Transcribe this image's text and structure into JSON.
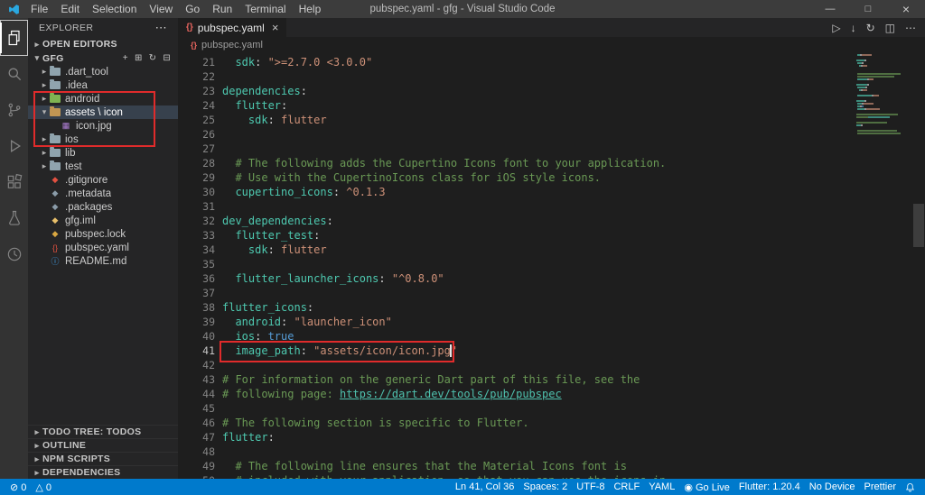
{
  "titlebar": {
    "title": "pubspec.yaml - gfg - Visual Studio Code",
    "menus": [
      "File",
      "Edit",
      "Selection",
      "View",
      "Go",
      "Run",
      "Terminal",
      "Help"
    ],
    "window_controls": {
      "minimize": "—",
      "maximize": "□",
      "close": "×"
    }
  },
  "icons": {
    "chevron_right": "▸",
    "chevron_down": "▾"
  },
  "activity_bar": {
    "items": [
      "explorer",
      "search",
      "source-control",
      "run-debug",
      "extensions",
      "test",
      "flutter-devtools"
    ]
  },
  "sidebar": {
    "header": "EXPLORER",
    "header_more": "⋯",
    "open_editors_label": "OPEN EDITORS",
    "project": "GFG",
    "project_actions": [
      {
        "name": "new-file",
        "glyph": "+"
      },
      {
        "name": "new-folder",
        "glyph": "⊞"
      },
      {
        "name": "refresh-explorer",
        "glyph": "↻"
      },
      {
        "name": "collapse-folders",
        "glyph": "⊟"
      }
    ],
    "tree": [
      {
        "label": ".dart_tool",
        "depth": 0,
        "kind": "folder",
        "expanded": false,
        "color": "#90a4ae"
      },
      {
        "label": ".idea",
        "depth": 0,
        "kind": "folder",
        "expanded": false,
        "color": "#90a4ae"
      },
      {
        "label": "android",
        "depth": 0,
        "kind": "folder",
        "expanded": false,
        "color": "#7fb352"
      },
      {
        "label": "assets \\ icon",
        "depth": 0,
        "kind": "folder",
        "expanded": true,
        "selected": true,
        "color": "#c09553"
      },
      {
        "label": "icon.jpg",
        "depth": 1,
        "kind": "file",
        "glyph": "▦",
        "color": "#b180d7"
      },
      {
        "label": "ios",
        "depth": 0,
        "kind": "folder",
        "expanded": false,
        "color": "#90a4ae"
      },
      {
        "label": "lib",
        "depth": 0,
        "kind": "folder",
        "expanded": false,
        "color": "#90a4ae"
      },
      {
        "label": "test",
        "depth": 0,
        "kind": "folder",
        "expanded": false,
        "color": "#90a4ae"
      },
      {
        "label": ".gitignore",
        "depth": 0,
        "kind": "file",
        "glyph": "◆",
        "color": "#e25141"
      },
      {
        "label": ".metadata",
        "depth": 0,
        "kind": "file",
        "glyph": "◆",
        "color": "#8a9ba8"
      },
      {
        "label": ".packages",
        "depth": 0,
        "kind": "file",
        "glyph": "◆",
        "color": "#8a9ba8"
      },
      {
        "label": "gfg.iml",
        "depth": 0,
        "kind": "file",
        "glyph": "◆",
        "color": "#e8bf6a"
      },
      {
        "label": "pubspec.lock",
        "depth": 0,
        "kind": "file",
        "glyph": "◆",
        "color": "#d9a741"
      },
      {
        "label": "pubspec.yaml",
        "depth": 0,
        "kind": "file",
        "glyph": "{}",
        "color": "#e25141"
      },
      {
        "label": "README.md",
        "depth": 0,
        "kind": "file",
        "glyph": "ⓘ",
        "color": "#42a5f5"
      }
    ],
    "bottom_sections": [
      "TODO TREE: TODOS",
      "OUTLINE",
      "NPM SCRIPTS",
      "DEPENDENCIES"
    ]
  },
  "editor": {
    "tab": {
      "label": "pubspec.yaml",
      "icon_glyph": "{}",
      "close": "×"
    },
    "breadcrumb": "pubspec.yaml",
    "actions": [
      {
        "name": "run",
        "glyph": "▷"
      },
      {
        "name": "download",
        "glyph": "↓"
      },
      {
        "name": "sync",
        "glyph": "↻"
      },
      {
        "name": "split-editor",
        "glyph": "◫"
      },
      {
        "name": "more-actions",
        "glyph": "⋯"
      }
    ],
    "cursor": {
      "line": 41,
      "col": 36
    },
    "lines": [
      {
        "n": 21,
        "t": [
          [
            "  sdk",
            "k"
          ],
          [
            ": ",
            "p"
          ],
          [
            "\">=2.7.0 <3.0.0\"",
            "s"
          ]
        ]
      },
      {
        "n": 22,
        "t": []
      },
      {
        "n": 23,
        "t": [
          [
            "dependencies",
            "k"
          ],
          [
            ":",
            "p"
          ]
        ]
      },
      {
        "n": 24,
        "t": [
          [
            "  flutter",
            "k"
          ],
          [
            ":",
            "p"
          ]
        ]
      },
      {
        "n": 25,
        "t": [
          [
            "    sdk",
            "k"
          ],
          [
            ": ",
            "p"
          ],
          [
            "flutter",
            "s"
          ]
        ]
      },
      {
        "n": 26,
        "t": []
      },
      {
        "n": 27,
        "t": []
      },
      {
        "n": 28,
        "t": [
          [
            "  # The following adds the Cupertino Icons font to your application.",
            "c"
          ]
        ]
      },
      {
        "n": 29,
        "t": [
          [
            "  # Use with the CupertinoIcons class for iOS style icons.",
            "c"
          ]
        ]
      },
      {
        "n": 30,
        "t": [
          [
            "  cupertino_icons",
            "k"
          ],
          [
            ": ",
            "p"
          ],
          [
            "^0.1.3",
            "s"
          ]
        ]
      },
      {
        "n": 31,
        "t": []
      },
      {
        "n": 32,
        "t": [
          [
            "dev_dependencies",
            "k"
          ],
          [
            ":",
            "p"
          ]
        ]
      },
      {
        "n": 33,
        "t": [
          [
            "  flutter_test",
            "k"
          ],
          [
            ":",
            "p"
          ]
        ]
      },
      {
        "n": 34,
        "t": [
          [
            "    sdk",
            "k"
          ],
          [
            ": ",
            "p"
          ],
          [
            "flutter",
            "s"
          ]
        ]
      },
      {
        "n": 35,
        "t": []
      },
      {
        "n": 36,
        "t": [
          [
            "  flutter_launcher_icons",
            "k"
          ],
          [
            ": ",
            "p"
          ],
          [
            "\"^0.8.0\"",
            "s"
          ]
        ]
      },
      {
        "n": 37,
        "t": []
      },
      {
        "n": 38,
        "t": [
          [
            "flutter_icons",
            "k"
          ],
          [
            ":",
            "p"
          ]
        ]
      },
      {
        "n": 39,
        "t": [
          [
            "  android",
            "k"
          ],
          [
            ": ",
            "p"
          ],
          [
            "\"launcher_icon\"",
            "s"
          ]
        ]
      },
      {
        "n": 40,
        "t": [
          [
            "  ios",
            "k"
          ],
          [
            ": ",
            "p"
          ],
          [
            "true",
            "b"
          ]
        ]
      },
      {
        "n": 41,
        "t": [
          [
            "  image_path",
            "k"
          ],
          [
            ": ",
            "p"
          ],
          [
            "\"assets/icon/icon.jpg\"",
            "s"
          ]
        ]
      },
      {
        "n": 42,
        "t": []
      },
      {
        "n": 43,
        "t": [
          [
            "# For information on the generic Dart part of this file, see the",
            "c"
          ]
        ]
      },
      {
        "n": 44,
        "t": [
          [
            "# following page: ",
            "c"
          ],
          [
            "https://dart.dev/tools/pub/pubspec",
            "l"
          ]
        ]
      },
      {
        "n": 45,
        "t": []
      },
      {
        "n": 46,
        "t": [
          [
            "# The following section is specific to Flutter.",
            "c"
          ]
        ]
      },
      {
        "n": 47,
        "t": [
          [
            "flutter",
            "k"
          ],
          [
            ":",
            "p"
          ]
        ]
      },
      {
        "n": 48,
        "t": []
      },
      {
        "n": 49,
        "t": [
          [
            "  # The following line ensures that the Material Icons font is",
            "c"
          ]
        ]
      },
      {
        "n": 50,
        "t": [
          [
            "  # included with your application, so that you can use the icons in",
            "c"
          ]
        ]
      }
    ]
  },
  "status_bar": {
    "left": [
      {
        "name": "errors",
        "icon": "⊘",
        "text": "0"
      },
      {
        "name": "warnings",
        "icon": "△",
        "text": "0"
      }
    ],
    "right": [
      {
        "name": "cursor-position",
        "text": "Ln 41, Col 36"
      },
      {
        "name": "indentation",
        "text": "Spaces: 2"
      },
      {
        "name": "encoding",
        "text": "UTF-8"
      },
      {
        "name": "eol",
        "text": "CRLF"
      },
      {
        "name": "language-mode",
        "text": "YAML"
      },
      {
        "name": "go-live",
        "icon": "◉",
        "text": "Go Live"
      },
      {
        "name": "flutter-version",
        "text": "Flutter: 1.20.4"
      },
      {
        "name": "device",
        "text": "No Device"
      },
      {
        "name": "prettier",
        "text": "Prettier"
      },
      {
        "name": "notifications",
        "icon": "bell",
        "text": ""
      }
    ]
  },
  "colors": {
    "accent": "#007acc",
    "annotation": "#e02b2b",
    "key": "#4ec9b0",
    "string": "#ce9178",
    "comment": "#6a9955",
    "boolean": "#569cd6",
    "link": "#4fc1ae",
    "plain": "#d4d4d4"
  }
}
